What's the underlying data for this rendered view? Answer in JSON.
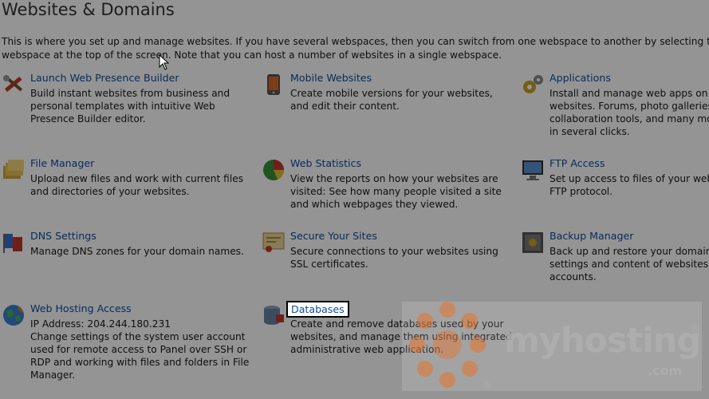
{
  "page": {
    "title": "Websites & Domains",
    "intro_line1": "This is where you set up and manage websites. If you have several webspaces, then you can switch from one webspace to another by selecting the requ",
    "intro_line2": "webspace at the top of the screen. Note that you can host a number of websites in a single webspace."
  },
  "items": [
    {
      "title": "Launch Web Presence Builder",
      "desc": [
        "Build instant websites from business and",
        "personal templates with intuitive Web",
        "Presence Builder editor."
      ],
      "icon": "tools-icon"
    },
    {
      "title": "Mobile Websites",
      "desc": [
        "Create mobile versions for your websites,",
        "and edit their content."
      ],
      "icon": "mobile-phone-icon"
    },
    {
      "title": "Applications",
      "desc": [
        "Install and manage web apps on your",
        "websites. Forums, photo galleries",
        "collaboration tools, and many mor",
        "in several clicks."
      ],
      "icon": "gears-icon"
    },
    {
      "title": "File Manager",
      "desc": [
        "Upload new files and work with current files",
        "and directories of your websites."
      ],
      "icon": "folders-icon"
    },
    {
      "title": "Web Statistics",
      "desc": [
        "View the reports on how your websites are",
        "visited: See how many people visited a site",
        "and which webpages they viewed."
      ],
      "icon": "pie-chart-icon"
    },
    {
      "title": "FTP Access",
      "desc": [
        "Set up access to files of your webs",
        "FTP protocol."
      ],
      "icon": "ftp-monitor-icon"
    },
    {
      "title": "DNS Settings",
      "desc": [
        "Manage DNS zones for your domain names."
      ],
      "icon": "dns-flags-icon"
    },
    {
      "title": "Secure Your Sites",
      "desc": [
        "Secure connections to your websites using",
        "SSL certificates."
      ],
      "icon": "certificate-icon"
    },
    {
      "title": "Backup Manager",
      "desc": [
        "Back up and restore your domains",
        "settings and content of websites a",
        "accounts."
      ],
      "icon": "safe-icon"
    },
    {
      "title": "Web Hosting Access",
      "desc": [
        "IP Address: 204.244.180.231",
        "Change settings of the system user account",
        "used for remote access to Panel over SSH or",
        "RDP and working with files and folders in File",
        "Manager."
      ],
      "icon": "globe-icon"
    },
    {
      "title": "Databases",
      "desc": [
        "Create and remove databases used by your",
        "websites, and manage them using integrated",
        "administrative web application."
      ],
      "icon": "database-icon"
    }
  ],
  "watermark": {
    "brand": "myhosting",
    "suffix": ".com",
    "reg": "®"
  },
  "colors": {
    "link": "#0b4ea2",
    "overlay": "rgba(0,0,0,0.42)",
    "watermark_orange": "#e8742a"
  }
}
